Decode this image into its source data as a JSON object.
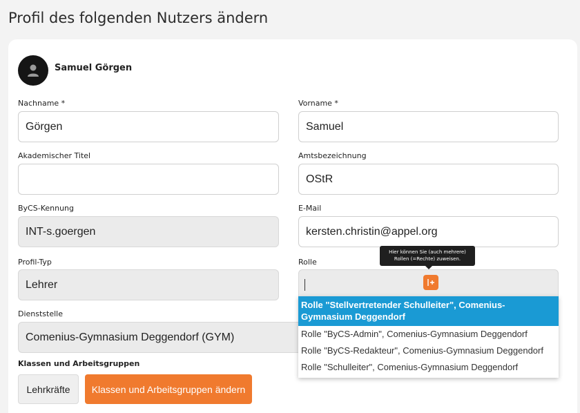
{
  "page": {
    "title": "Profil des folgenden Nutzers ändern"
  },
  "user": {
    "display_name": "Samuel Görgen",
    "avatar_icon": "user-silhouette-icon"
  },
  "form": {
    "nachname": {
      "label": "Nachname *",
      "value": "Görgen"
    },
    "vorname": {
      "label": "Vorname *",
      "value": "Samuel"
    },
    "akad_titel": {
      "label": "Akademischer Titel",
      "value": ""
    },
    "amtsbezeichnung": {
      "label": "Amtsbezeichnung",
      "value": "OStR"
    },
    "bycs_kennung": {
      "label": "ByCS-Kennung",
      "value": "INT-s.goergen"
    },
    "email": {
      "label": "E-Mail",
      "value": "kersten.christin@appel.org"
    },
    "profil_typ": {
      "label": "Profil-Typ",
      "value": "Lehrer"
    },
    "rolle": {
      "label": "Rolle",
      "value": "",
      "tooltip_line1": "Hier können Sie (auch mehrere)",
      "tooltip_line2": "Rollen (=Rechte) zuweisen.",
      "options": [
        "Rolle \"Stellvertretender Schulleiter\", Comenius-Gymnasium Deggendorf",
        "Rolle \"ByCS-Admin\", Comenius-Gymnasium Deggendorf",
        "Rolle \"ByCS-Redakteur\", Comenius-Gymnasium Deggendorf",
        "Rolle \"Schulleiter\", Comenius-Gymnasium Deggendorf"
      ],
      "highlighted_index": 0
    },
    "dienststelle": {
      "label": "Dienststelle",
      "value": "Comenius-Gymnasium Deggendorf (GYM)"
    },
    "klassen": {
      "label": "Klassen und Arbeitsgruppen",
      "chip_label": "Lehrkräfte",
      "change_button_label": "Klassen und Arbeitsgruppen ändern"
    }
  },
  "colors": {
    "accent": "#f07a2e",
    "highlight": "#1a9ad4",
    "disabled_bg": "#ebebeb"
  }
}
